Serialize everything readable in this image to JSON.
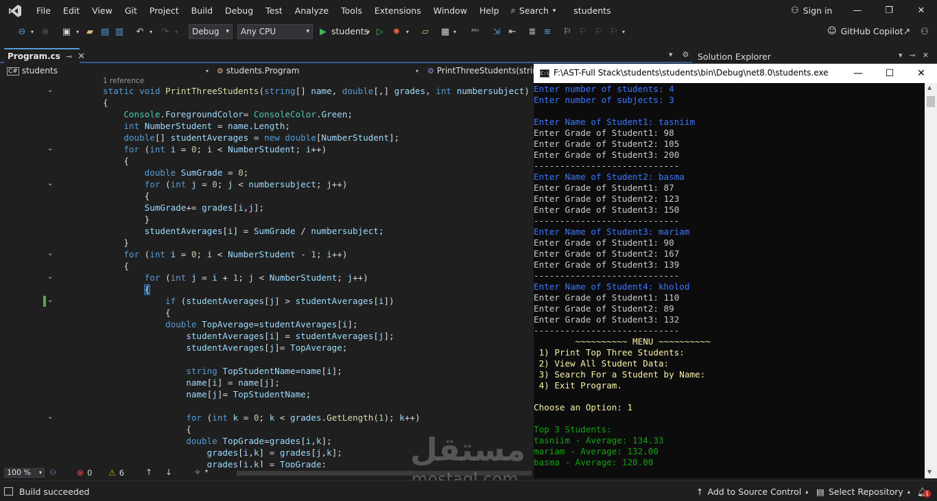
{
  "menu": {
    "items": [
      "File",
      "Edit",
      "View",
      "Git",
      "Project",
      "Build",
      "Debug",
      "Test",
      "Analyze",
      "Tools",
      "Extensions",
      "Window",
      "Help"
    ],
    "search_label": "Search",
    "solution_name": "students",
    "sign_in": "Sign in"
  },
  "toolbar": {
    "configuration": "Debug",
    "platform": "Any CPU",
    "run_target": "students",
    "copilot_label": "GitHub Copilot"
  },
  "tabs": {
    "active_tab": "Program.cs"
  },
  "navbar": {
    "project": "students",
    "type": "students.Program",
    "member": "PrintThreeStudents(string"
  },
  "editor": {
    "codelens": "1 reference",
    "lines": [
      "static void PrintThreeStudents(string[] name, double[,] grades, int numbersubject)",
      "{",
      "    Console.ForegroundColor= ConsoleColor.Green;",
      "    int NumberStudent = name.Length;",
      "    double[] studentAverages = new double[NumberStudent];",
      "    for (int i = 0; i < NumberStudent; i++)",
      "    {",
      "        double SumGrade = 0;",
      "        for (int j = 0; j < numbersubject; j++)",
      "        {",
      "        SumGrade+= grades[i,j];",
      "        }",
      "        studentAverages[i] = SumGrade / numbersubject;",
      "    }",
      "    for (int i = 0; i < NumberStudent - 1; i++)",
      "    {",
      "        for (int j = i + 1; j < NumberStudent; j++)",
      "        {",
      "            if (studentAverages[j] > studentAverages[i])",
      "            {",
      "            double TopAverage=studentAverages[i];",
      "                studentAverages[i] = studentAverages[j];",
      "                studentAverages[j]= TopAverage;",
      "",
      "                string TopStudentName=name[i];",
      "                name[i] = name[j];",
      "                name[j]= TopStudentName;",
      "",
      "                for (int k = 0; k < grades.GetLength(1); k++)",
      "                {",
      "                double TopGrade=grades[i,k];",
      "                    grades[i,k] = grades[j,k];",
      "                    grades[i,k] = TopGrade;"
    ],
    "zoom": "100 %",
    "errors": "0",
    "warnings": "6"
  },
  "solution_explorer": {
    "title": "Solution Explorer"
  },
  "console": {
    "path": "F:\\AST-Full Stack\\students\\students\\bin\\Debug\\net8.0\\students.exe",
    "lines": [
      {
        "text": "Enter number of students: 4",
        "color": "blue"
      },
      {
        "text": "Enter number of subjects: 3",
        "color": "blue"
      },
      {
        "text": "",
        "color": "white"
      },
      {
        "text": "Enter Name of Student1: tasniim",
        "color": "blue"
      },
      {
        "text": "Enter Grade of Student1: 98",
        "color": "white"
      },
      {
        "text": "Enter Grade of Student2: 105",
        "color": "white"
      },
      {
        "text": "Enter Grade of Student3: 200",
        "color": "white"
      },
      {
        "text": "----------------------------",
        "color": "white"
      },
      {
        "text": "Enter Name of Student2: basma",
        "color": "blue"
      },
      {
        "text": "Enter Grade of Student1: 87",
        "color": "white"
      },
      {
        "text": "Enter Grade of Student2: 123",
        "color": "white"
      },
      {
        "text": "Enter Grade of Student3: 150",
        "color": "white"
      },
      {
        "text": "----------------------------",
        "color": "white"
      },
      {
        "text": "Enter Name of Student3: mariam",
        "color": "blue"
      },
      {
        "text": "Enter Grade of Student1: 90",
        "color": "white"
      },
      {
        "text": "Enter Grade of Student2: 167",
        "color": "white"
      },
      {
        "text": "Enter Grade of Student3: 139",
        "color": "white"
      },
      {
        "text": "----------------------------",
        "color": "white"
      },
      {
        "text": "Enter Name of Student4: kholod",
        "color": "blue"
      },
      {
        "text": "Enter Grade of Student1: 110",
        "color": "white"
      },
      {
        "text": "Enter Grade of Student2: 89",
        "color": "white"
      },
      {
        "text": "Enter Grade of Student3: 132",
        "color": "white"
      },
      {
        "text": "----------------------------",
        "color": "white"
      },
      {
        "text": "        ~~~~~~~~~~ MENU ~~~~~~~~~~",
        "color": "yellow"
      },
      {
        "text": " 1) Print Top Three Students:",
        "color": "yellow"
      },
      {
        "text": " 2) View All Student Data:",
        "color": "yellow"
      },
      {
        "text": " 3) Search For a Student by Name:",
        "color": "yellow"
      },
      {
        "text": " 4) Exit Program.",
        "color": "yellow"
      },
      {
        "text": "",
        "color": "white"
      },
      {
        "text": "Choose an Option: 1",
        "color": "yellow"
      },
      {
        "text": "",
        "color": "white"
      },
      {
        "text": "Top 3 Students:",
        "color": "green"
      },
      {
        "text": "tasniim - Average: 134.33",
        "color": "green"
      },
      {
        "text": "mariam - Average: 132.00",
        "color": "green"
      },
      {
        "text": "basma - Average: 120.00",
        "color": "green"
      }
    ]
  },
  "statusbar": {
    "build_status": "Build succeeded",
    "add_source_control": "Add to Source Control",
    "select_repository": "Select Repository",
    "notifications_count": "1"
  },
  "watermark": {
    "arabic": "مستقل",
    "latin": "mostaql.com"
  },
  "colors": {
    "accent": "#569cd6",
    "keyword": "#569cd6",
    "type": "#4ec9b0",
    "method": "#dcdcaa",
    "variable": "#9cdcfe",
    "number": "#b5cea8",
    "console_blue": "#3b78ff",
    "console_yellow": "#f9f1a5",
    "console_green": "#13a10e"
  }
}
